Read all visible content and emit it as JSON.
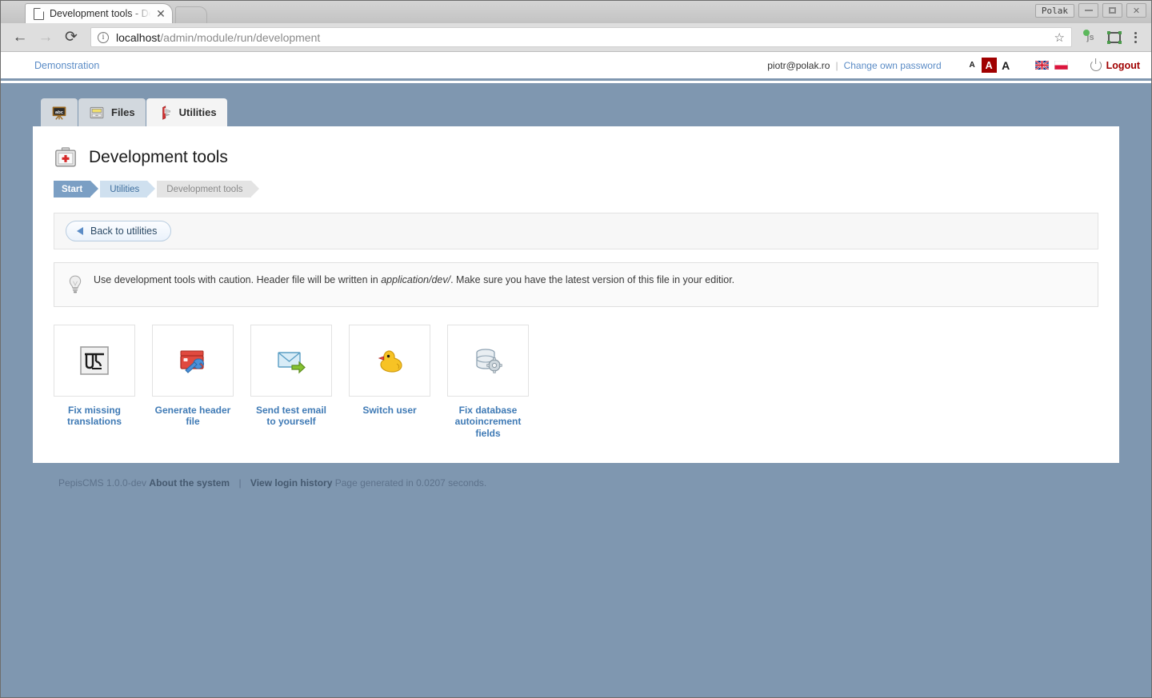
{
  "window": {
    "user_badge": "Polak",
    "minimize": "—",
    "maximize": "□",
    "close": "✕"
  },
  "browser": {
    "tab_title": "Development tools - De",
    "tab_close": "✕",
    "back_icon": "←",
    "forward_icon": "→",
    "reload_icon": "⟳",
    "info_icon": "i",
    "url_host": "localhost",
    "url_path": "/admin/module/run/development",
    "star_icon": "☆",
    "js_extension": "js",
    "menu_icon": "kebab-menu"
  },
  "app": {
    "brand": "Demonstration",
    "user_email": "piotr@polak.ro",
    "separator": "|",
    "change_password": "Change own password",
    "font_small": "A",
    "font_medium": "A",
    "font_large": "A",
    "logout": "Logout",
    "accent_red": "#a00000",
    "page_background": "#7f97b0",
    "link_blue": "#5b8cc6"
  },
  "tabs": [
    {
      "label": "",
      "icon": "blackboard-icon",
      "active": false
    },
    {
      "label": "Files",
      "icon": "drawer-icon",
      "active": false
    },
    {
      "label": "Utilities",
      "icon": "swiss-army-knife-icon",
      "active": true
    }
  ],
  "page": {
    "title": "Development tools",
    "title_icon": "first-aid-kit-icon",
    "breadcrumb": [
      {
        "label": "Start"
      },
      {
        "label": "Utilities"
      },
      {
        "label": "Development tools"
      }
    ],
    "back_button": "Back to utilities",
    "notice_icon": "lightbulb-icon",
    "notice_part1": "Use development tools with caution. Header file will be written in ",
    "notice_emphasis": "application/dev/",
    "notice_part2": ". Make sure you have the latest version of this file in your editior."
  },
  "tools": [
    {
      "label": "Fix missing translations",
      "icon": "devanagari-translation-icon"
    },
    {
      "label": "Generate header file",
      "icon": "card-wrench-icon"
    },
    {
      "label": "Send test email to yourself",
      "icon": "envelope-arrow-icon"
    },
    {
      "label": "Switch user",
      "icon": "rubber-duck-icon"
    },
    {
      "label": "Fix database autoincrement fields",
      "icon": "database-gear-icon"
    }
  ],
  "footer": {
    "version": "PepisCMS 1.0.0-dev",
    "about": "About the system",
    "separator": "|",
    "login_history": "View login history",
    "generation": "Page generated in 0.0207 seconds."
  }
}
